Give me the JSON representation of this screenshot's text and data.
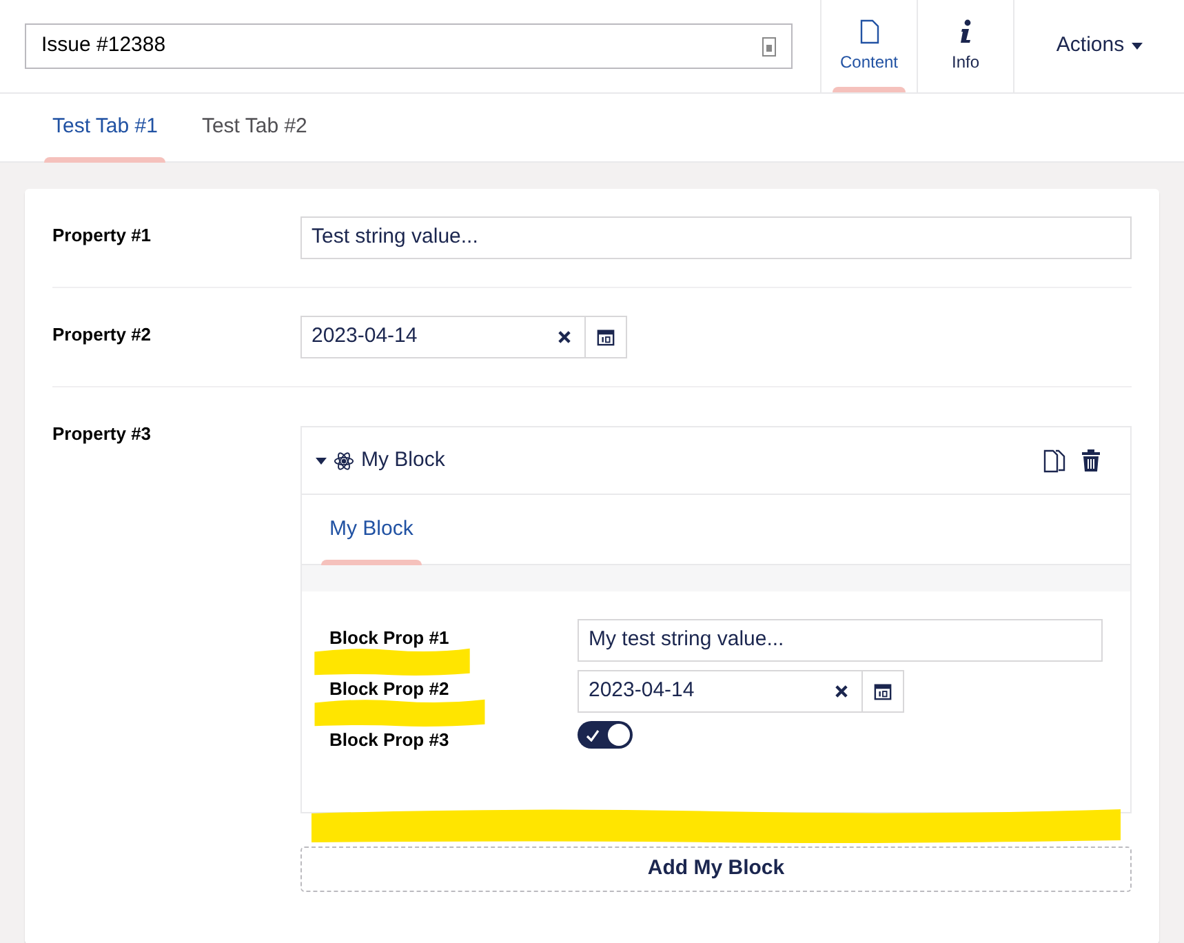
{
  "header": {
    "title": "Issue #12388",
    "apps": [
      {
        "kind": "document",
        "label": "Content",
        "selected": true
      },
      {
        "kind": "info",
        "label": "Info",
        "selected": false
      }
    ],
    "actions": "Actions"
  },
  "tabs": [
    {
      "label": "Test Tab #1",
      "selected": true
    },
    {
      "label": "Test Tab #2",
      "selected": false
    }
  ],
  "properties": [
    {
      "kind": "text",
      "label": "Property #1",
      "value": "Test string value..."
    },
    {
      "kind": "date",
      "label": "Property #2",
      "value": "2023-04-14"
    },
    {
      "kind": "blocks",
      "label": "Property #3",
      "block": {
        "title": "My Block",
        "expanded": true,
        "highlighted": true,
        "tabs": [
          {
            "label": "My Block",
            "selected": true
          }
        ],
        "properties": [
          {
            "kind": "text",
            "label": "Block Prop #1",
            "value": "My test string value...",
            "highlighted": true
          },
          {
            "kind": "date",
            "label": "Block Prop #2",
            "value": "2023-04-14",
            "highlighted": true
          },
          {
            "kind": "toggle",
            "label": "Block Prop #3",
            "checked": true,
            "highlighted": false
          }
        ]
      },
      "add_button": "Add My Block"
    }
  ]
}
